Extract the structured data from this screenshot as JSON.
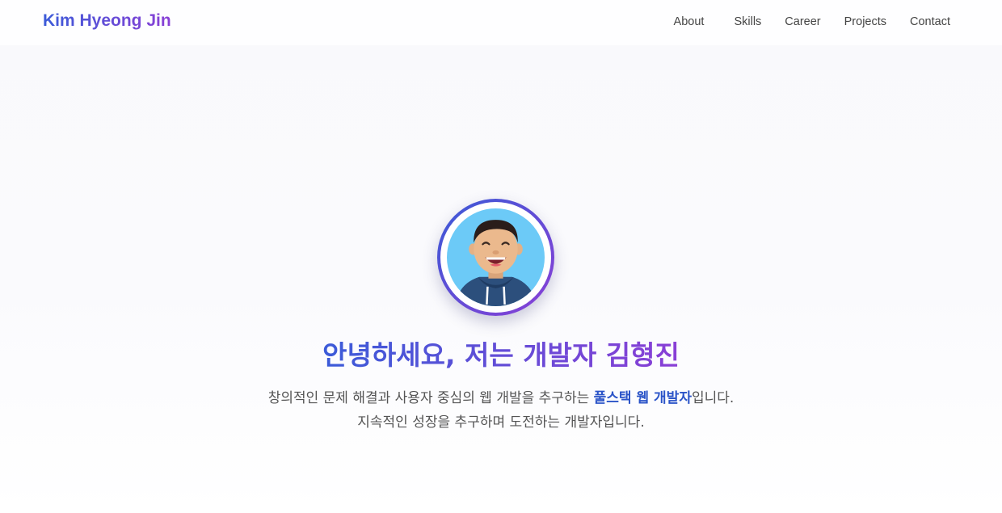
{
  "nav": {
    "brand": "Kim Hyeong Jin",
    "links": [
      {
        "label": "About"
      },
      {
        "label": "Skills"
      },
      {
        "label": "Career"
      },
      {
        "label": "Projects"
      },
      {
        "label": "Contact"
      }
    ]
  },
  "hero": {
    "avatar_icon": "developer-avatar",
    "title": "안녕하세요, 저는 개발자 김형진",
    "desc_line1_prefix": "창의적인 문제 해결과 사용자 중심의 웹 개발을 추구하는 ",
    "desc_line1_highlight": "풀스택 웹 개발자",
    "desc_line1_suffix": "입니다.",
    "desc_line2": "지속적인 성장을 추구하며 도전하는 개발자입니다."
  },
  "colors": {
    "gradient_start": "#3b5bd8",
    "gradient_end": "#8a3fd6",
    "highlight": "#2b54c8",
    "avatar_bg": "#6ccaf7",
    "hoodie": "#2c4f7c"
  }
}
